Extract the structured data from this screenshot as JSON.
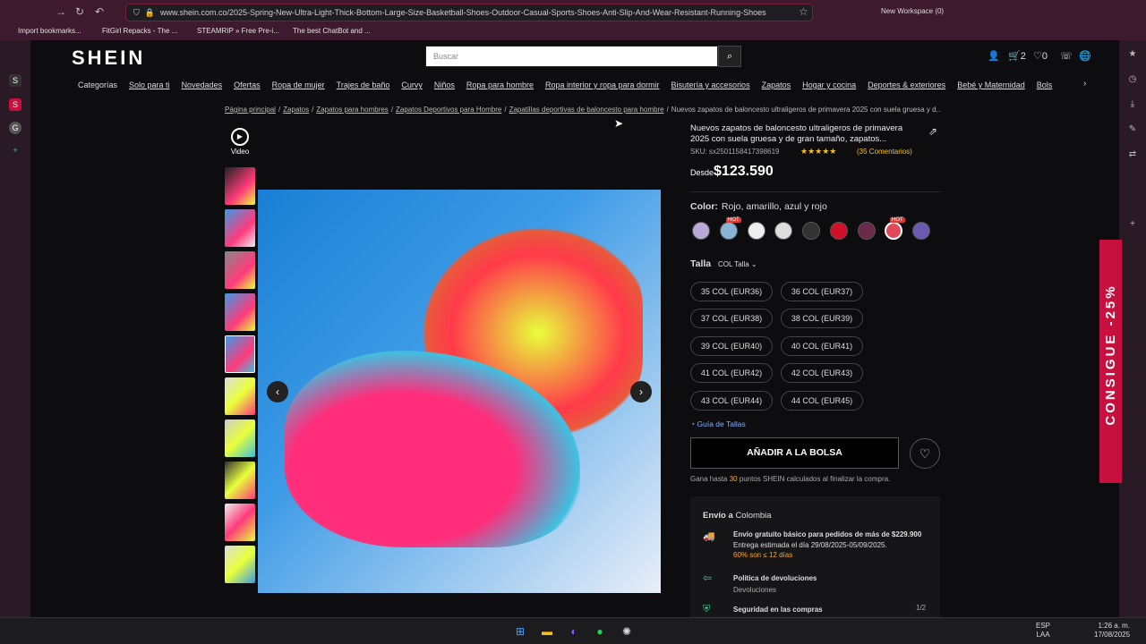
{
  "browser": {
    "url": "www.shein.com.co/2025-Spring-New-Ultra-Light-Thick-Bottom-Large-Size-Basketball-Shoes-Outdoor-Casual-Sports-Shoes-Anti-Slip-And-Wear-Resistant-Running-Shoes",
    "workspace": "New Workspace (0)",
    "bookmarks": [
      "Import bookmarks...",
      "FitGirl Repacks - The ...",
      "STEAMRIP » Free Pre-i...",
      "The best ChatBot and ..."
    ]
  },
  "sidebar": {
    "items": [
      "S",
      "S",
      "G",
      "+"
    ]
  },
  "header": {
    "logo": "SHEIN",
    "search_placeholder": "Buscar",
    "cart_count": "2",
    "wish_count": "0"
  },
  "nav": {
    "items": [
      "Categorías",
      "Solo para ti",
      "Novedades",
      "Ofertas",
      "Ropa de mujer",
      "Trajes de baño",
      "Curvy",
      "Niños",
      "Ropa para hombre",
      "Ropa interior y ropa para dormir",
      "Bisutería y accesorios",
      "Zapatos",
      "Hogar y cocina",
      "Deportes & exteriores",
      "Bebé y Maternidad",
      "Bols"
    ]
  },
  "breadcrumb": [
    "Página principal",
    "/",
    "Zapatos",
    "/",
    "Zapatos para hombres",
    "/",
    "Zapatos Deportivos para Hombre",
    "/",
    "Zapatillas deportivas de baloncesto para hombre",
    "/",
    "Nuevos zapatos de baloncesto ultraligeros de primavera 2025 con suela gruesa y d..."
  ],
  "gallery": {
    "video_label": "Video"
  },
  "product": {
    "title": "Nuevos zapatos de baloncesto ultraligeros de primavera 2025 con suela gruesa y de gran tamaño, zapatos...",
    "sku": "SKU: sx2501158417398619",
    "rating": "★★★★★",
    "reviews": "(35 Comentarios)",
    "price_prefix": "Desde",
    "price_currency": "$",
    "price": "123.590",
    "color_label": "Color:",
    "color_value": "Rojo, amarillo, azul y rojo",
    "hot": "HOT",
    "size_label": "Talla",
    "size_system": "COL Talla",
    "sizes": [
      "35 COL (EUR36)",
      "36 COL (EUR37)",
      "37 COL (EUR38)",
      "38 COL (EUR39)",
      "39 COL (EUR40)",
      "40 COL (EUR41)",
      "41 COL (EUR42)",
      "42 COL (EUR43)",
      "43 COL (EUR44)",
      "44 COL (EUR45)"
    ],
    "size_guide": "Guía de Tallas",
    "add_to_bag": "AÑADIR A LA BOLSA",
    "points_pre": "Gana hasta",
    "points": "30",
    "points_post": "puntos SHEIN calculados al finalizar la compra."
  },
  "shipping": {
    "to": "Envío a",
    "country": "Colombia",
    "free": "Envío gratuito básico para pedidos de más de $229.900",
    "eta": "Entrega estimada el día 29/08/2025-05/09/2025.",
    "pct": "60% son ≤ 12 días",
    "returns": "Política de devoluciones",
    "returns_sub": "Devoluciones",
    "security": "Seguridad en las compras",
    "pager": "1/2"
  },
  "promo": {
    "text": "CONSIGUE -25%"
  },
  "taskbar": {
    "lang1": "ESP",
    "lang2": "LAA",
    "time": "1:26 a. m.",
    "date": "17/08/2025"
  }
}
